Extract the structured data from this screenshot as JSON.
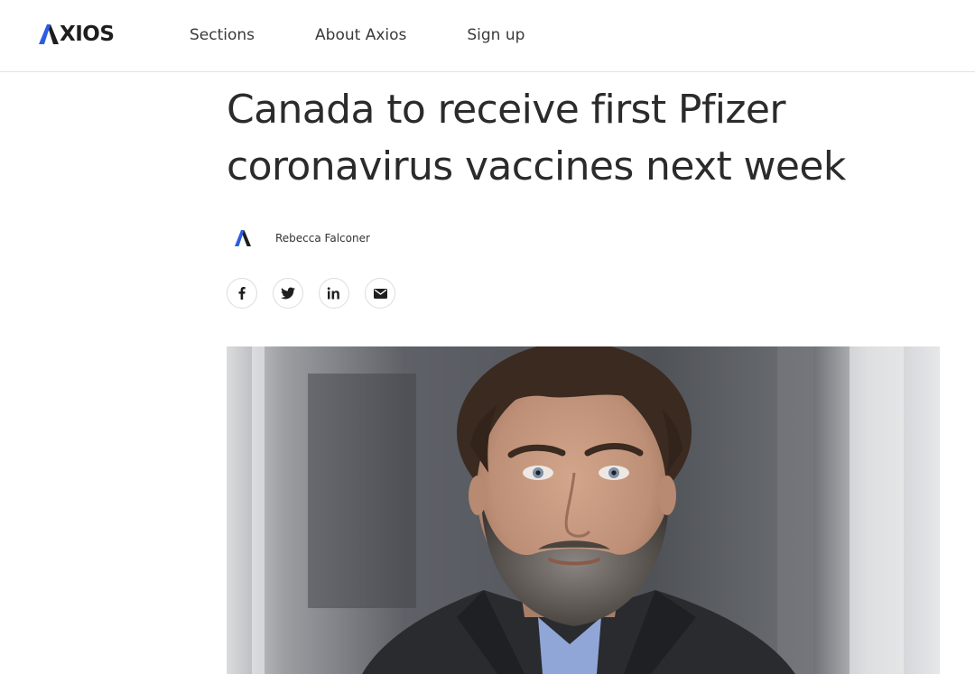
{
  "brand": {
    "logo_text": "XIOS",
    "accent_color": "#2d5de4",
    "logo_icon": "axios-logo-icon"
  },
  "nav": {
    "items": [
      {
        "label": "Sections"
      },
      {
        "label": "About Axios"
      },
      {
        "label": "Sign up"
      }
    ]
  },
  "article": {
    "headline": "Canada to receive first Pfizer coronavirus vaccines next week",
    "author": "Rebecca Falconer",
    "author_icon": "axios-author-avatar-icon",
    "share": [
      {
        "network": "facebook",
        "icon": "facebook-icon"
      },
      {
        "network": "twitter",
        "icon": "twitter-icon"
      },
      {
        "network": "linkedin",
        "icon": "linkedin-icon"
      },
      {
        "network": "email",
        "icon": "email-icon"
      }
    ]
  },
  "hero_image": {
    "description_icon": "portrait-photo",
    "colors": {
      "background_left": "#d9dbdd",
      "background_mid": "#5f6268",
      "coat": "#2c2d30",
      "shirt": "#8fa6d6",
      "hair": "#3b2a20",
      "skin": "#c99b82"
    }
  }
}
